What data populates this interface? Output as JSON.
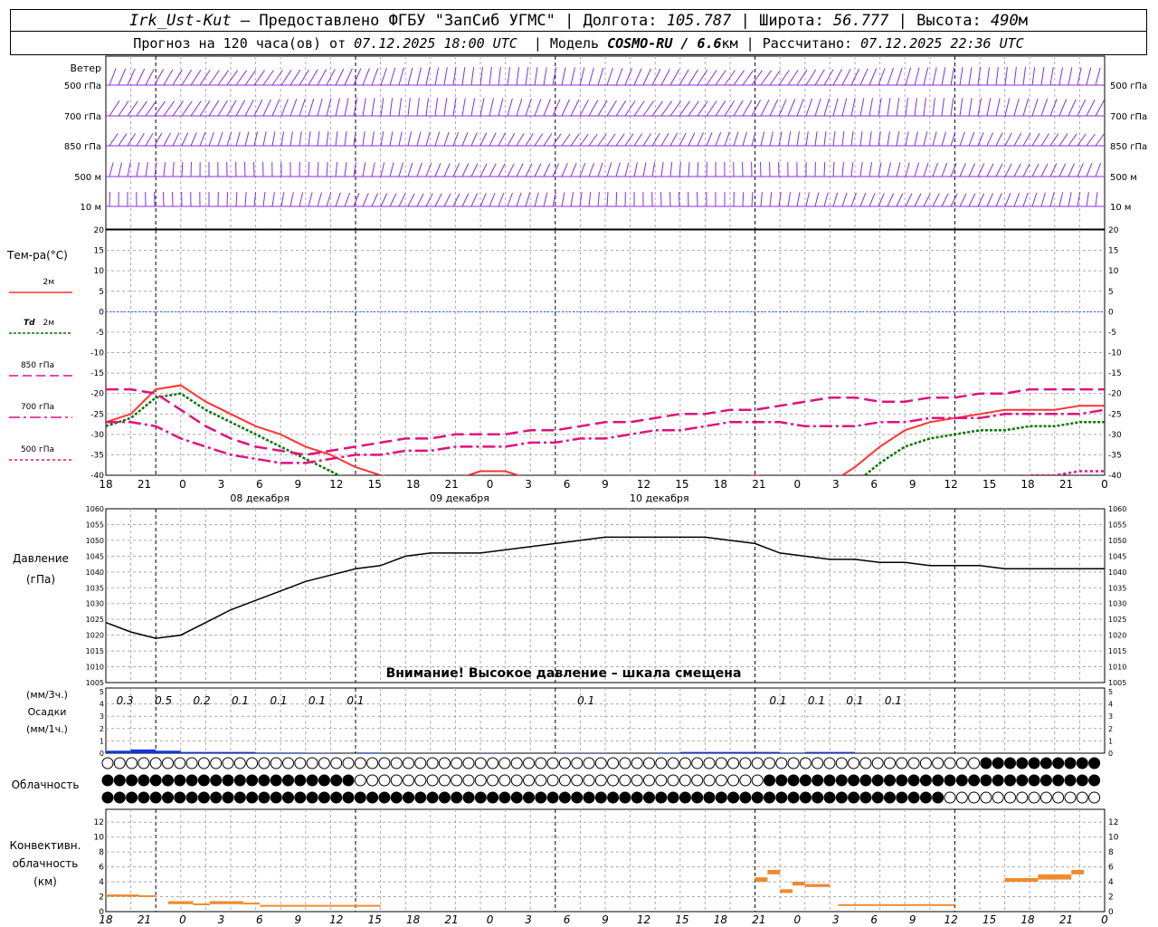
{
  "header": {
    "station": "Irk_Ust-Kut",
    "provider": "– Предоставлено ФГБУ \"ЗапСиб УГМС\" |",
    "lon_label": "Долгота:",
    "lon": "105.787",
    "lat_label": "| Широта:",
    "lat": "56.777",
    "alt_label": "| Высота:",
    "alt": "490",
    "alt_unit": "м",
    "forecast_prefix": "Прогноз на 120 часа(ов) от",
    "init_time": "07.12.2025 18:00 UTC",
    "model_label": "| Модель",
    "model": "COSMO-RU / 6.6",
    "model_unit": "км",
    "calc_label": "| Рассчитано:",
    "calc_time": "07.12.2025 22:36 UTC"
  },
  "wind": {
    "title": "Ветер",
    "levels": [
      "500 гПа",
      "700 гПа",
      "850 гПа",
      "500 м",
      "10 м"
    ]
  },
  "temperature": {
    "title": "Тем-ра(°C)",
    "ticks": [
      20,
      15,
      10,
      5,
      0,
      -5,
      -10,
      -15,
      -20,
      -25,
      -30,
      -35,
      -40
    ],
    "legend": [
      {
        "label": "2м",
        "prefix": "",
        "color": "#ff3333",
        "dash": ""
      },
      {
        "label": "2м",
        "prefix": "Td",
        "color": "#007700",
        "dash": "3,2"
      },
      {
        "label": "850 гПа",
        "prefix": "",
        "color": "#e0107f",
        "dash": "10,5"
      },
      {
        "label": "700 гПа",
        "prefix": "",
        "color": "#e0107f",
        "dash": "12,4,3,4"
      },
      {
        "label": "500 гПа",
        "prefix": "",
        "color": "#e0107f",
        "dash": "3,3"
      }
    ]
  },
  "x_axis": {
    "hour_labels": [
      "18",
      "21",
      "0",
      "3",
      "6",
      "9",
      "12",
      "15",
      "18",
      "21",
      "0",
      "3",
      "6",
      "9",
      "12",
      "15",
      "18",
      "21",
      "0",
      "3",
      "6",
      "9",
      "12",
      "15",
      "18",
      "21",
      "0"
    ],
    "day_labels": [
      "08 декабря",
      "09 декабря",
      "10 декабря"
    ]
  },
  "pressure": {
    "title": "Давление",
    "unit": "(гПа)",
    "ticks": [
      1060,
      1055,
      1050,
      1045,
      1040,
      1035,
      1030,
      1025,
      1020,
      1015,
      1010,
      1005
    ],
    "warning": "Внимание! Высокое давление – шкала смещена"
  },
  "precip": {
    "unit_3h": "(мм/3ч.)",
    "title": "Осадки",
    "unit_1h": "(мм/1ч.)",
    "ticks": [
      5,
      4,
      3,
      2,
      1,
      0
    ],
    "labels_3h": [
      "0.3",
      "0.5",
      "0.2",
      "0.1",
      "0.1",
      "0.1",
      "0.1",
      "",
      "",
      "",
      "",
      "",
      "0.1",
      "",
      "",
      "",
      "",
      "0.1",
      "0.1",
      "0.1",
      "0.1",
      "",
      "",
      "",
      "",
      "",
      ""
    ]
  },
  "cloud": {
    "title": "Облачность"
  },
  "convective": {
    "title1": "Конвективн.",
    "title2": "облачность",
    "unit": "(км)",
    "ticks": [
      12,
      10,
      8,
      6,
      4,
      2,
      0
    ]
  },
  "chart_data": [
    {
      "type": "line",
      "title": "Тем-ра(°C)",
      "x_hours": [
        -6,
        -3,
        0,
        3,
        6,
        9,
        12,
        15,
        18,
        21,
        24,
        27,
        30,
        33,
        36,
        39,
        42,
        45,
        48,
        51,
        54,
        57,
        60,
        63,
        66,
        69,
        72,
        75,
        78,
        81,
        84,
        87,
        90,
        93,
        96,
        99,
        102,
        105,
        108,
        111,
        114
      ],
      "ylim": [
        -40,
        20
      ],
      "series": [
        {
          "name": "2м",
          "values": [
            -27,
            -25,
            -19,
            -18,
            -22,
            -25,
            -28,
            -30,
            -33,
            -35,
            -38,
            -40,
            -41,
            -42,
            -41,
            -39,
            -39,
            -41,
            -43,
            -45,
            -46,
            -46,
            -45,
            -44,
            -42,
            -41,
            -40,
            -41,
            -43,
            -42,
            -38,
            -33,
            -29,
            -27,
            -26,
            -25,
            -24,
            -24,
            -24,
            -23,
            -23
          ]
        },
        {
          "name": "Td 2м",
          "values": [
            -28,
            -26,
            -21,
            -20,
            -24,
            -27,
            -30,
            -33,
            -36,
            -39,
            -42,
            -44,
            -45,
            -46,
            -45,
            -44,
            -44,
            -45,
            -47,
            -48,
            -49,
            -49,
            -48,
            -47,
            -46,
            -45,
            -45,
            -46,
            -47,
            -46,
            -42,
            -37,
            -33,
            -31,
            -30,
            -29,
            -29,
            -28,
            -28,
            -27,
            -27
          ]
        },
        {
          "name": "850 гПа",
          "values": [
            -19,
            -19,
            -20,
            -24,
            -28,
            -31,
            -33,
            -34,
            -35,
            -34,
            -33,
            -32,
            -31,
            -31,
            -30,
            -30,
            -30,
            -29,
            -29,
            -28,
            -27,
            -27,
            -26,
            -25,
            -25,
            -24,
            -24,
            -23,
            -22,
            -21,
            -21,
            -22,
            -22,
            -21,
            -21,
            -20,
            -20,
            -19,
            -19,
            -19,
            -19
          ]
        },
        {
          "name": "700 гПа",
          "values": [
            -27,
            -27,
            -28,
            -31,
            -33,
            -35,
            -36,
            -37,
            -37,
            -36,
            -35,
            -35,
            -34,
            -34,
            -33,
            -33,
            -33,
            -32,
            -32,
            -31,
            -31,
            -30,
            -29,
            -29,
            -28,
            -27,
            -27,
            -27,
            -28,
            -28,
            -28,
            -27,
            -27,
            -26,
            -26,
            -26,
            -25,
            -25,
            -25,
            -25,
            -24
          ]
        },
        {
          "name": "500 гПа",
          "values": [
            -46,
            -46,
            -45,
            -45,
            -46,
            -46,
            -46,
            -47,
            -47,
            -46,
            -46,
            -45,
            -45,
            -45,
            -45,
            -44,
            -44,
            -44,
            -43,
            -43,
            -43,
            -43,
            -42,
            -42,
            -42,
            -41,
            -41,
            -41,
            -41,
            -41,
            -41,
            -41,
            -41,
            -41,
            -41,
            -41,
            -41,
            -40,
            -40,
            -39,
            -39
          ]
        }
      ]
    },
    {
      "type": "line",
      "title": "Давление",
      "x_hours": [
        -6,
        -3,
        0,
        3,
        6,
        9,
        12,
        15,
        18,
        21,
        24,
        27,
        30,
        33,
        36,
        39,
        42,
        45,
        48,
        51,
        54,
        57,
        60,
        63,
        66,
        69,
        72,
        75,
        78,
        81,
        84,
        87,
        90,
        93,
        96,
        99,
        102,
        105,
        108,
        111,
        114
      ],
      "ylim": [
        1005,
        1060
      ],
      "series": [
        {
          "name": "Давление",
          "values": [
            1024,
            1021,
            1019,
            1020,
            1024,
            1028,
            1031,
            1034,
            1037,
            1039,
            1041,
            1042,
            1045,
            1046,
            1046,
            1046,
            1047,
            1048,
            1049,
            1050,
            1051,
            1051,
            1051,
            1051,
            1051,
            1050,
            1049,
            1046,
            1045,
            1044,
            1044,
            1043,
            1043,
            1042,
            1042,
            1042,
            1041,
            1041,
            1041,
            1041,
            1041
          ]
        }
      ]
    },
    {
      "type": "bar",
      "title": "Осадки",
      "x_hours": [
        -6,
        -3,
        0,
        3,
        6,
        9,
        12,
        15,
        18,
        21,
        24,
        27,
        30,
        33,
        36,
        39,
        42,
        45,
        48,
        51,
        54,
        57,
        60,
        63,
        66,
        69,
        72,
        75,
        78,
        81,
        84,
        87,
        90,
        93,
        96,
        99,
        102,
        105,
        108,
        111,
        114
      ],
      "ylim": [
        0,
        5
      ],
      "values": [
        0.2,
        0.3,
        0.2,
        0.1,
        0.1,
        0.1,
        0.05,
        0.05,
        0.02,
        0,
        0.05,
        0,
        0,
        0,
        0,
        0.02,
        0,
        0,
        0.02,
        0.02,
        0,
        0,
        0.05,
        0.1,
        0.1,
        0.1,
        0.1,
        0.05,
        0.1,
        0.1,
        0,
        0,
        0,
        0,
        0,
        0,
        0,
        0,
        0,
        0,
        0
      ]
    },
    {
      "type": "bar",
      "title": "Конвективн. облачность",
      "ylim": [
        0,
        13
      ],
      "segments": [
        {
          "from": -6,
          "to": -2,
          "bottom": 2.0,
          "top": 2.3
        },
        {
          "from": -2,
          "to": 0,
          "bottom": 2.0,
          "top": 2.2
        },
        {
          "from": 1.5,
          "to": 4.5,
          "bottom": 1.0,
          "top": 1.4
        },
        {
          "from": 4.5,
          "to": 6.5,
          "bottom": 1.0,
          "top": 1.1
        },
        {
          "from": 6.5,
          "to": 10.5,
          "bottom": 1.0,
          "top": 1.4
        },
        {
          "from": 10.5,
          "to": 12.5,
          "bottom": 1.0,
          "top": 1.2
        },
        {
          "from": 12.5,
          "to": 27,
          "bottom": 0.8,
          "top": 0.9
        },
        {
          "from": 72,
          "to": 73.5,
          "bottom": 4.0,
          "top": 4.6
        },
        {
          "from": 73.5,
          "to": 75,
          "bottom": 5.0,
          "top": 5.6
        },
        {
          "from": 75,
          "to": 76.5,
          "bottom": 2.5,
          "top": 3.0
        },
        {
          "from": 76.5,
          "to": 78,
          "bottom": 3.5,
          "top": 4.0
        },
        {
          "from": 78,
          "to": 81,
          "bottom": 3.3,
          "top": 3.7
        },
        {
          "from": 82,
          "to": 96,
          "bottom": 0.9,
          "top": 1.0
        },
        {
          "from": 102,
          "to": 106,
          "bottom": 4.0,
          "top": 4.5
        },
        {
          "from": 106,
          "to": 110,
          "bottom": 4.3,
          "top": 5.0
        },
        {
          "from": 110,
          "to": 111.5,
          "bottom": 5.0,
          "top": 5.6
        }
      ]
    }
  ]
}
